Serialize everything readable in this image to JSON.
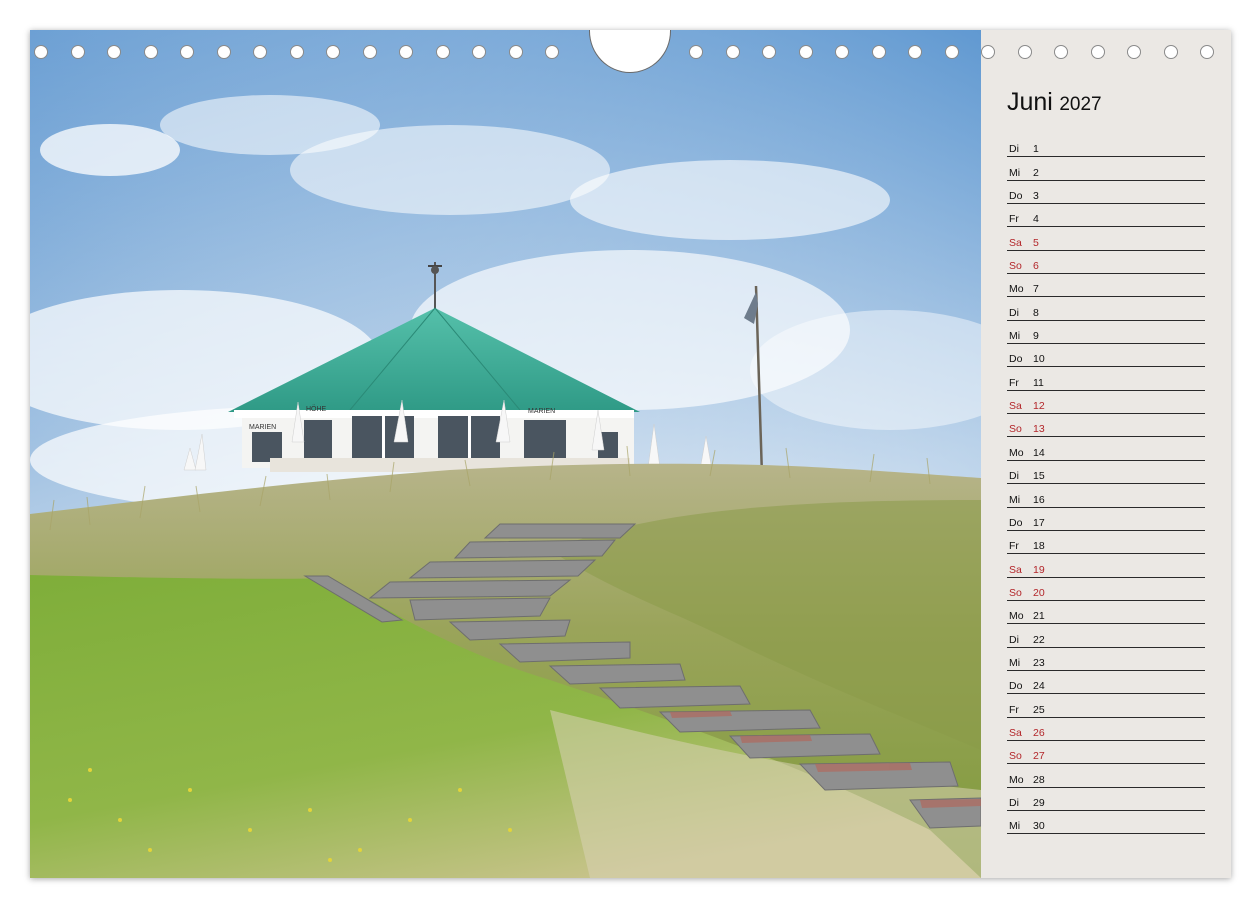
{
  "calendar": {
    "month": "Juni",
    "year": "2027",
    "weekend_color": "#b3262a",
    "days": [
      {
        "wd": "Di",
        "d": "1",
        "weekend": false
      },
      {
        "wd": "Mi",
        "d": "2",
        "weekend": false
      },
      {
        "wd": "Do",
        "d": "3",
        "weekend": false
      },
      {
        "wd": "Fr",
        "d": "4",
        "weekend": false
      },
      {
        "wd": "Sa",
        "d": "5",
        "weekend": true
      },
      {
        "wd": "So",
        "d": "6",
        "weekend": true
      },
      {
        "wd": "Mo",
        "d": "7",
        "weekend": false
      },
      {
        "wd": "Di",
        "d": "8",
        "weekend": false
      },
      {
        "wd": "Mi",
        "d": "9",
        "weekend": false
      },
      {
        "wd": "Do",
        "d": "10",
        "weekend": false
      },
      {
        "wd": "Fr",
        "d": "11",
        "weekend": false
      },
      {
        "wd": "Sa",
        "d": "12",
        "weekend": true
      },
      {
        "wd": "So",
        "d": "13",
        "weekend": true
      },
      {
        "wd": "Mo",
        "d": "14",
        "weekend": false
      },
      {
        "wd": "Di",
        "d": "15",
        "weekend": false
      },
      {
        "wd": "Mi",
        "d": "16",
        "weekend": false
      },
      {
        "wd": "Do",
        "d": "17",
        "weekend": false
      },
      {
        "wd": "Fr",
        "d": "18",
        "weekend": false
      },
      {
        "wd": "Sa",
        "d": "19",
        "weekend": true
      },
      {
        "wd": "So",
        "d": "20",
        "weekend": true
      },
      {
        "wd": "Mo",
        "d": "21",
        "weekend": false
      },
      {
        "wd": "Di",
        "d": "22",
        "weekend": false
      },
      {
        "wd": "Mi",
        "d": "23",
        "weekend": false
      },
      {
        "wd": "Do",
        "d": "24",
        "weekend": false
      },
      {
        "wd": "Fr",
        "d": "25",
        "weekend": false
      },
      {
        "wd": "Sa",
        "d": "26",
        "weekend": true
      },
      {
        "wd": "So",
        "d": "27",
        "weekend": true
      },
      {
        "wd": "Mo",
        "d": "28",
        "weekend": false
      },
      {
        "wd": "Di",
        "d": "29",
        "weekend": false
      },
      {
        "wd": "Mi",
        "d": "30",
        "weekend": false
      }
    ]
  },
  "photo": {
    "building_sign_left": "MARIEN",
    "building_sign_mid": "HÖHE",
    "building_sign_right": "MARIEN",
    "roof_color": "#3fae9a",
    "sky_color": "#4f8fcc",
    "grass_color": "#8fae3e"
  }
}
